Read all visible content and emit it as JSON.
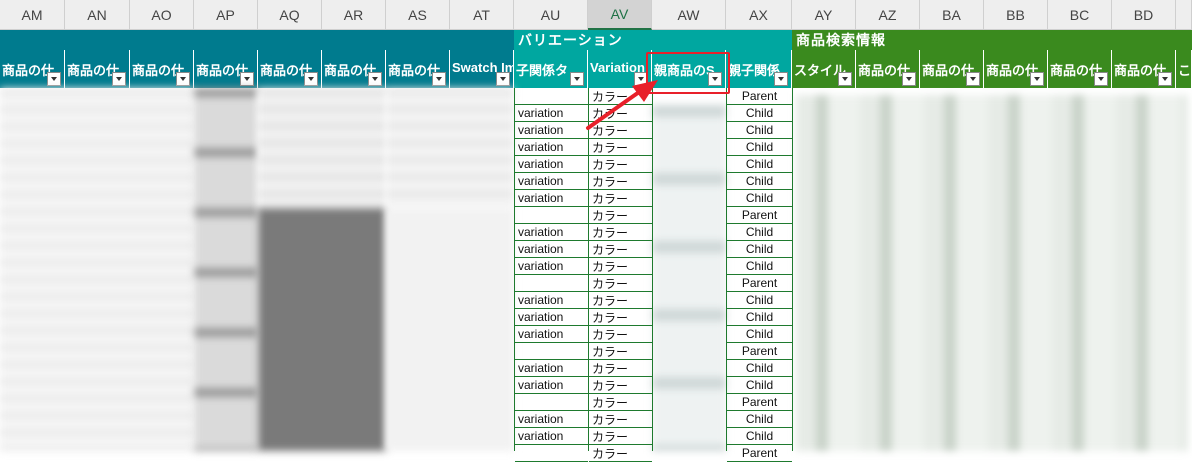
{
  "columns": [
    "AM",
    "AN",
    "AO",
    "AP",
    "AQ",
    "AR",
    "AS",
    "AT",
    "AU",
    "AV",
    "AW",
    "AX",
    "AY",
    "AZ",
    "BA",
    "BB",
    "BC",
    "BD"
  ],
  "selected_column": "AV",
  "section_bands": {
    "variation": "バリエーション",
    "search": "商品検索情報"
  },
  "header_labels": {
    "am": "商品の仕",
    "an": "商品の仕",
    "ao": "商品の仕",
    "ap": "商品の仕",
    "aq": "商品の仕",
    "ar": "商品の仕",
    "as": "商品の仕",
    "at": "Swatch Im",
    "au": "子関係タ",
    "av": "Variation",
    "aw": "親商品のS",
    "ax": "親子関係",
    "ay": "スタイル",
    "az": "商品の仕",
    "ba": "商品の仕",
    "bb": "商品の仕",
    "bc": "商品の仕",
    "bd": "商品の仕",
    "be": "こ"
  },
  "rows": [
    {
      "relation": "",
      "variation": "カラー",
      "parent_child": "Parent"
    },
    {
      "relation": "variation",
      "variation": "カラー",
      "parent_child": "Child"
    },
    {
      "relation": "variation",
      "variation": "カラー",
      "parent_child": "Child"
    },
    {
      "relation": "variation",
      "variation": "カラー",
      "parent_child": "Child"
    },
    {
      "relation": "variation",
      "variation": "カラー",
      "parent_child": "Child"
    },
    {
      "relation": "variation",
      "variation": "カラー",
      "parent_child": "Child"
    },
    {
      "relation": "variation",
      "variation": "カラー",
      "parent_child": "Child"
    },
    {
      "relation": "",
      "variation": "カラー",
      "parent_child": "Parent"
    },
    {
      "relation": "variation",
      "variation": "カラー",
      "parent_child": "Child"
    },
    {
      "relation": "variation",
      "variation": "カラー",
      "parent_child": "Child"
    },
    {
      "relation": "variation",
      "variation": "カラー",
      "parent_child": "Child"
    },
    {
      "relation": "",
      "variation": "カラー",
      "parent_child": "Parent"
    },
    {
      "relation": "variation",
      "variation": "カラー",
      "parent_child": "Child"
    },
    {
      "relation": "variation",
      "variation": "カラー",
      "parent_child": "Child"
    },
    {
      "relation": "variation",
      "variation": "カラー",
      "parent_child": "Child"
    },
    {
      "relation": "",
      "variation": "カラー",
      "parent_child": "Parent"
    },
    {
      "relation": "variation",
      "variation": "カラー",
      "parent_child": "Child"
    },
    {
      "relation": "variation",
      "variation": "カラー",
      "parent_child": "Child"
    },
    {
      "relation": "",
      "variation": "カラー",
      "parent_child": "Parent"
    },
    {
      "relation": "variation",
      "variation": "カラー",
      "parent_child": "Child"
    },
    {
      "relation": "variation",
      "variation": "カラー",
      "parent_child": "Child"
    },
    {
      "relation": "",
      "variation": "カラー",
      "parent_child": "Parent"
    }
  ],
  "colors": {
    "teal_header": "#007b8e",
    "teal_band": "#00a7a0",
    "green_header": "#3a8a1e",
    "annotation": "#e8202a"
  }
}
